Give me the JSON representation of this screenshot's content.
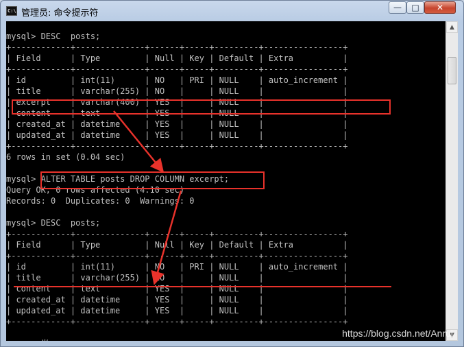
{
  "window": {
    "title": "管理员: 命令提示符",
    "icon_text": "C:\\.",
    "min_glyph": "—",
    "max_glyph": "□",
    "close_glyph": "✕"
  },
  "console": {
    "lines": [
      "",
      "mysql> DESC  posts;",
      "+------------+--------------+------+-----+---------+----------------+",
      "| Field      | Type         | Null | Key | Default | Extra          |",
      "+------------+--------------+------+-----+---------+----------------+",
      "| id         | int(11)      | NO   | PRI | NULL    | auto_increment |",
      "| title      | varchar(255) | NO   |     | NULL    |                |",
      "| excerpt    | varchar(400) | YES  |     | NULL    |                |",
      "| content    | text         | YES  |     | NULL    |                |",
      "| created_at | datetime     | YES  |     | NULL    |                |",
      "| updated_at | datetime     | YES  |     | NULL    |                |",
      "+------------+--------------+------+-----+---------+----------------+",
      "6 rows in set (0.04 sec)",
      "",
      "mysql> ALTER TABLE posts DROP COLUMN excerpt;",
      "Query OK, 0 rows affected (4.10 sec)",
      "Records: 0  Duplicates: 0  Warnings: 0",
      "",
      "mysql> DESC  posts;",
      "+------------+--------------+------+-----+---------+----------------+",
      "| Field      | Type         | Null | Key | Default | Extra          |",
      "+------------+--------------+------+-----+---------+----------------+",
      "| id         | int(11)      | NO   | PRI | NULL    | auto_increment |",
      "| title      | varchar(255) | NO   |     | NULL    |                |",
      "| content    | text         | YES  |     | NULL    |                |",
      "| created_at | datetime     | YES  |     | NULL    |                |",
      "| updated_at | datetime     | YES  |     | NULL    |                |",
      "+------------+--------------+------+-----+---------+----------------+",
      "",
      "       半:"
    ]
  },
  "scrollbar": {
    "up_glyph": "▲",
    "down_glyph": "▼"
  },
  "watermark": "https://blog.csdn.net/Anrui",
  "colors": {
    "console_bg": "#000000",
    "console_text": "#c0c0c0",
    "highlight": "#e8322b"
  }
}
